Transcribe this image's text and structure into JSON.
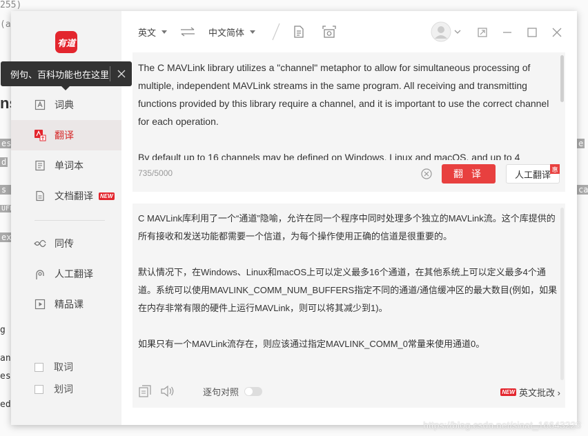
{
  "background": {
    "fragments": [
      "255)",
      "(a",
      "ns",
      "es",
      "d",
      "s n",
      "UFF",
      "ex",
      "g is",
      "an",
      "es",
      "ed",
      "e",
      "cal"
    ]
  },
  "sidebar": {
    "logo_text": "有道",
    "nav": [
      {
        "label": "词典",
        "icon": "dictionary-icon",
        "active": false
      },
      {
        "label": "翻译",
        "icon": "translate-icon",
        "active": true
      },
      {
        "label": "单词本",
        "icon": "wordbook-icon",
        "active": false
      },
      {
        "label": "文档翻译",
        "icon": "document-icon",
        "active": false,
        "badge": "NEW"
      },
      {
        "label": "同传",
        "icon": "simultaneous-icon",
        "active": false
      },
      {
        "label": "人工翻译",
        "icon": "human-translate-icon",
        "active": false
      },
      {
        "label": "精品课",
        "icon": "course-icon",
        "active": false
      }
    ],
    "checks": [
      {
        "label": "取词"
      },
      {
        "label": "划词"
      }
    ]
  },
  "tooltip": {
    "text": "例句、百科功能也在这里"
  },
  "toolbar": {
    "source_lang": "英文",
    "target_lang": "中文简体"
  },
  "source": {
    "paragraphs": [
      "The C MAVLink library utilizes a \"channel\" metaphor to allow for simultaneous processing of multiple, independent MAVLink streams in the same program. All receiving and transmitting functions provided by this library require a channel, and it is important to use the correct channel for each operation.",
      "By default up to 16 channels may be defined on Windows, Linux and macOS, and up to 4"
    ],
    "count": "735/5000",
    "translate_label": "翻 译",
    "human_label": "人工翻译",
    "human_badge": "惠"
  },
  "result": {
    "paragraphs": [
      "C MAVLink库利用了一个“通道”隐喻，允许在同一个程序中同时处理多个独立的MAVLink流。这个库提供的所有接收和发送功能都需要一个信道，为每个操作使用正确的信道是很重要的。",
      "默认情况下，在Windows、Linux和macOS上可以定义最多16个通道，在其他系统上可以定义最多4个通道。系统可以使用MAVLINK_COMM_NUM_BUFFERS指定不同的通道/通信缓冲区的最大数目(例如，如果在内存非常有限的硬件上运行MAVLink，则可以将其减少到1)。",
      "如果只有一个MAVLink流存在，则应该通过指定MAVLINK_COMM_0常量来使用通道0。"
    ],
    "compare_label": "逐句对照",
    "correct_badge": "NEW",
    "correct_label": "英文批改 ›"
  },
  "watermark": "https://blog.csdn.net/sinat_16643223"
}
